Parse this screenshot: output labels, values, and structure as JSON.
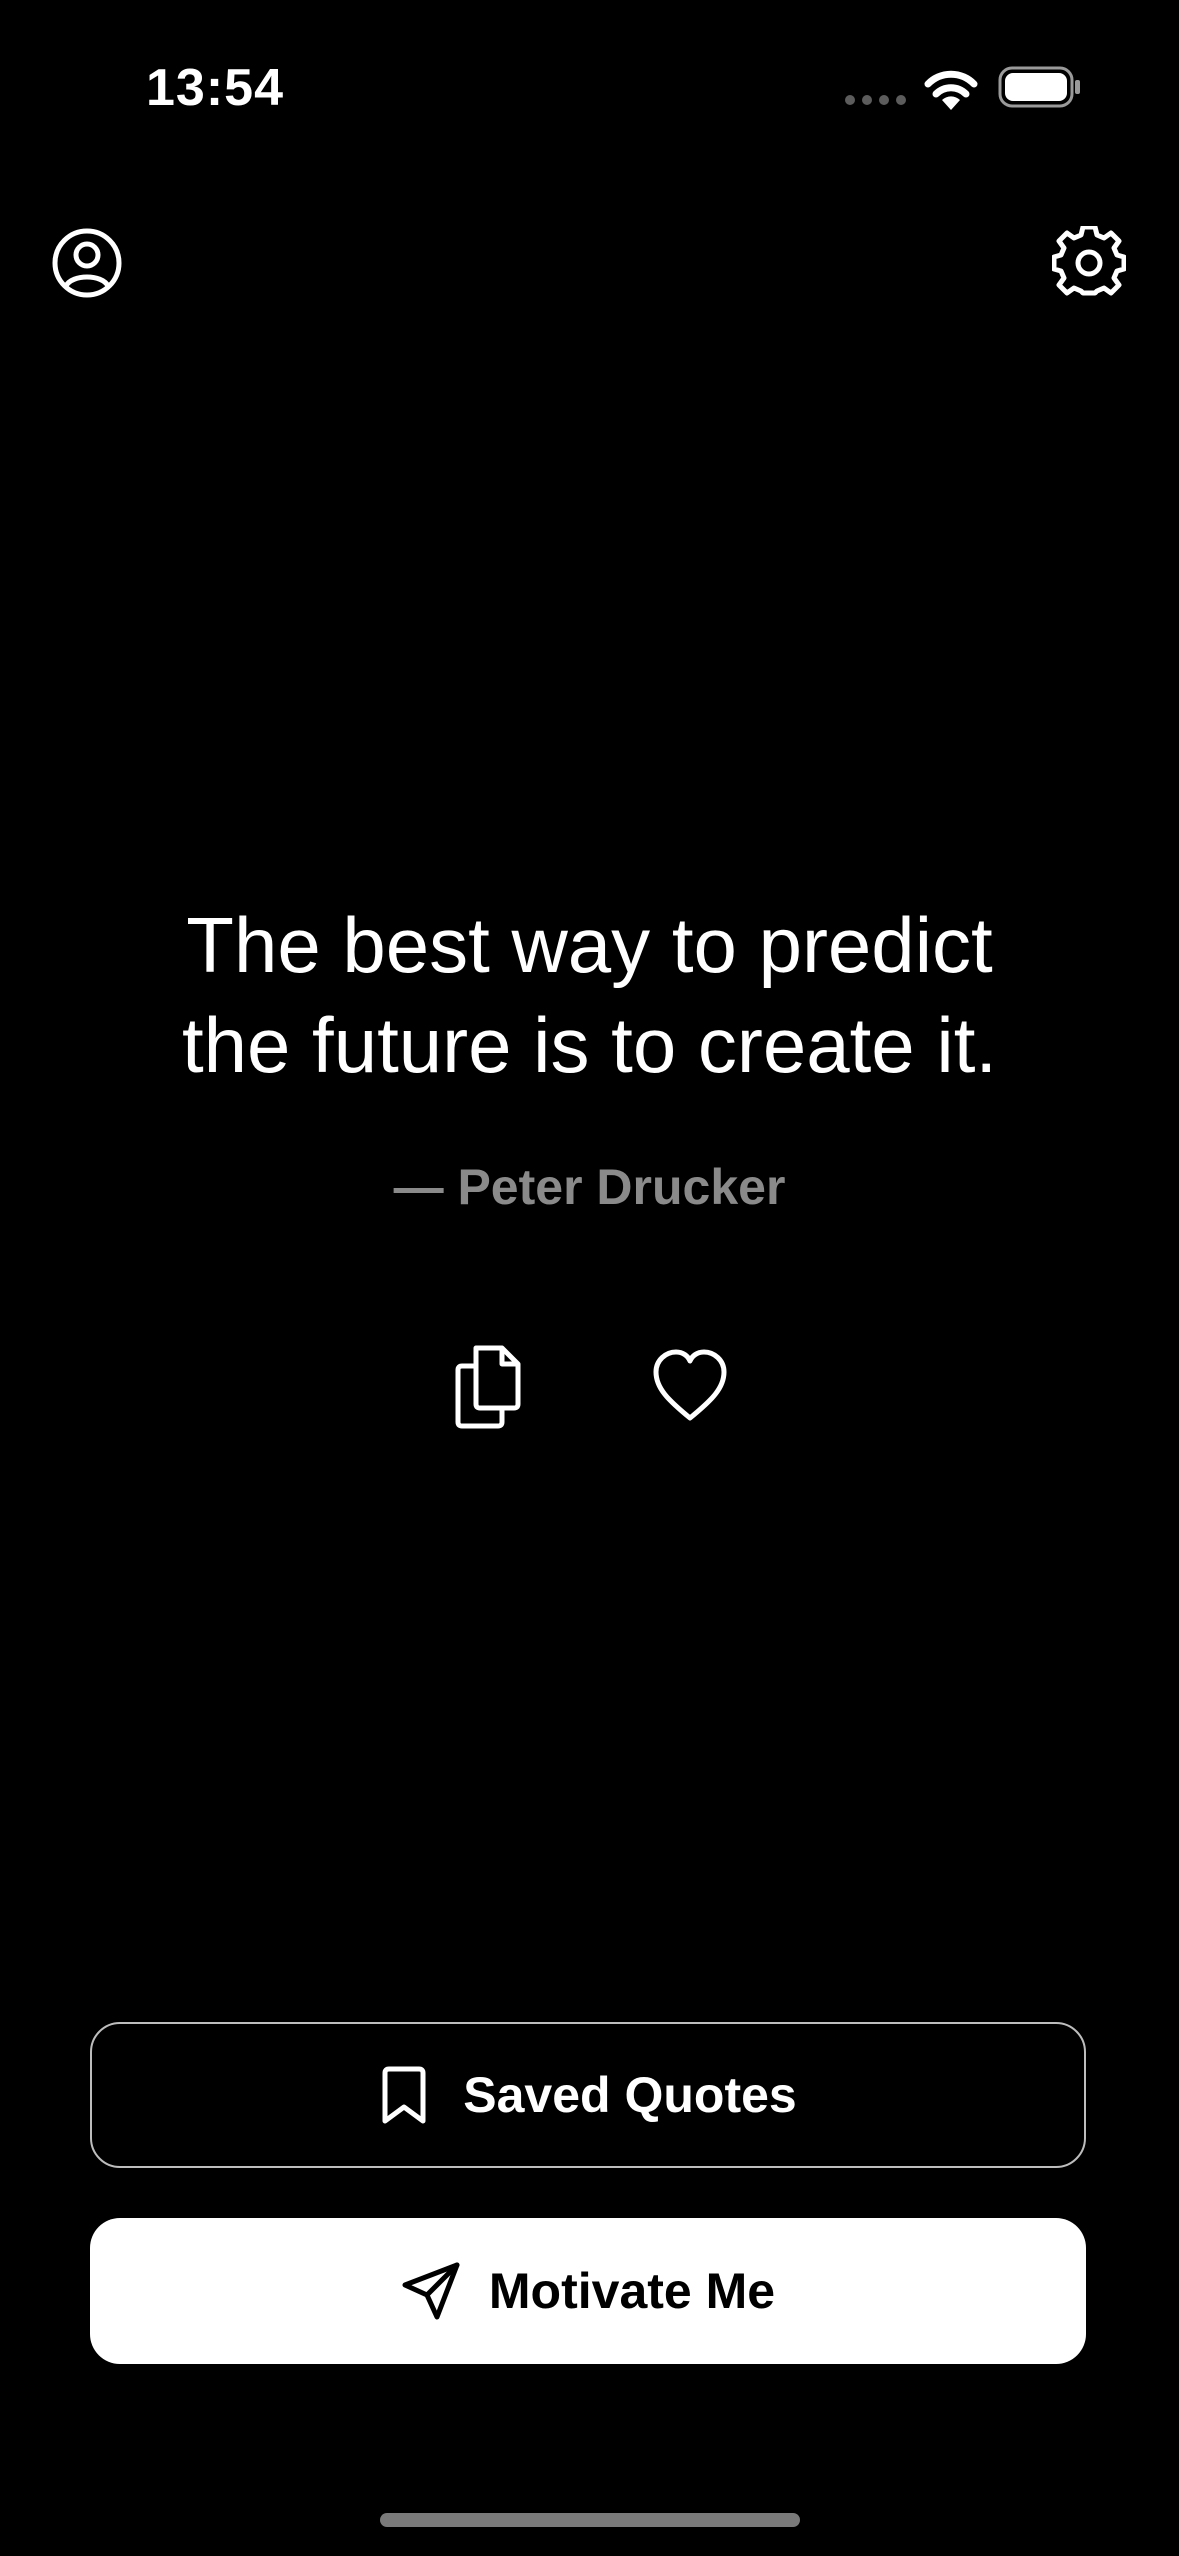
{
  "status_bar": {
    "time": "13:54"
  },
  "header": {
    "profile_icon": "person-circle-icon",
    "settings_icon": "gear-icon"
  },
  "quote": {
    "text_line1": "The best way to predict",
    "text_line2": "the future is to create it.",
    "author": "— Peter Drucker"
  },
  "actions": {
    "copy_icon": "copy-icon",
    "favorite_icon": "heart-icon"
  },
  "buttons": {
    "saved_quotes_label": "Saved Quotes",
    "saved_quotes_icon": "bookmark-icon",
    "motivate_label": "Motivate Me",
    "motivate_icon": "paper-plane-icon"
  },
  "colors": {
    "background": "#000000",
    "text_primary": "#ffffff",
    "text_secondary": "#8a8a8a",
    "primary_button_bg": "#ffffff",
    "primary_button_text": "#000000",
    "outline_button_border": "#bdbdbd"
  }
}
